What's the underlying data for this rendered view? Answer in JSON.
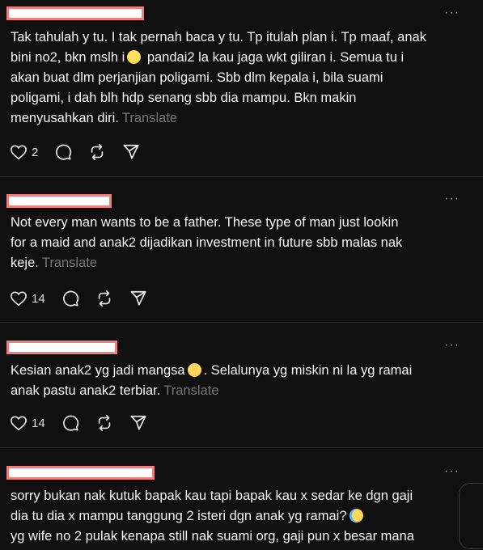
{
  "posts": [
    {
      "lines": [
        "Tak tahulah y tu. I tak pernah baca y tu. Tp itulah plan i. Tp maaf, anak",
        "bini no2, bkn mslh i",
        " pandai2 la kau jaga wkt giliran i. Semua tu i",
        "akan buat dlm perjanjian poligami. Sbb dlm kepala i, bila suami",
        "poligami, i dah blh hdp senang sbb dia mampu. Bkn makin",
        "menyusahkan diri."
      ],
      "translate": "Translate",
      "likes": "2",
      "more": "···"
    },
    {
      "lines": [
        "Not every man wants to be a father. These type of man just lookin",
        "for a maid and anak2 dijadikan investment in future sbb malas nak",
        "keje."
      ],
      "translate": "Translate",
      "likes": "14",
      "more": "···"
    },
    {
      "lines": [
        "Kesian anak2 yg jadi mangsa",
        ". Selalunya yg miskin ni la yg ramai",
        "anak pastu anak2 terbiar."
      ],
      "translate": "Translate",
      "likes": "14",
      "more": "···"
    },
    {
      "lines": [
        "sorry bukan nak kutuk bapak kau tapi bapak kau x sedar ke dgn gaji",
        "dia tu dia x mampu tanggung 2 isteri dgn anak yg ramai?",
        "yg wife no 2 pulak kenapa still nak suami org, gaji pun x besar mana"
      ],
      "more": "···"
    }
  ],
  "icons": [
    "heart-icon",
    "comment-icon",
    "repost-icon",
    "share-icon",
    "more-icon",
    "emoji-icon"
  ],
  "colors": {
    "background": "#101010",
    "text": "#f3f5f7",
    "muted": "#777777",
    "redaction_border": "#ef7f7f",
    "redaction_fill": "#ffffff"
  }
}
